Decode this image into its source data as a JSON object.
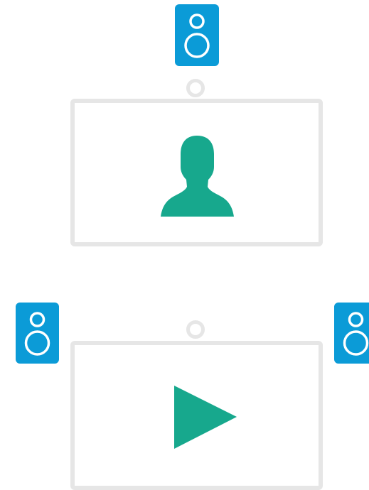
{
  "colors": {
    "speaker": "#0b9bd7",
    "speaker_glyph": "#ffffff",
    "frame": "#e6e6e6",
    "content": "#17a88d",
    "background": "#ffffff"
  },
  "room_top": {
    "speakers": [
      {
        "icon": "speaker-icon"
      }
    ],
    "camera": {
      "icon": "camera-icon"
    },
    "display": {
      "content_icon": "person-icon"
    }
  },
  "room_bottom": {
    "speakers": [
      {
        "icon": "speaker-icon"
      },
      {
        "icon": "speaker-icon"
      }
    ],
    "camera": {
      "icon": "camera-icon"
    },
    "display": {
      "content_icon": "play-icon"
    }
  }
}
